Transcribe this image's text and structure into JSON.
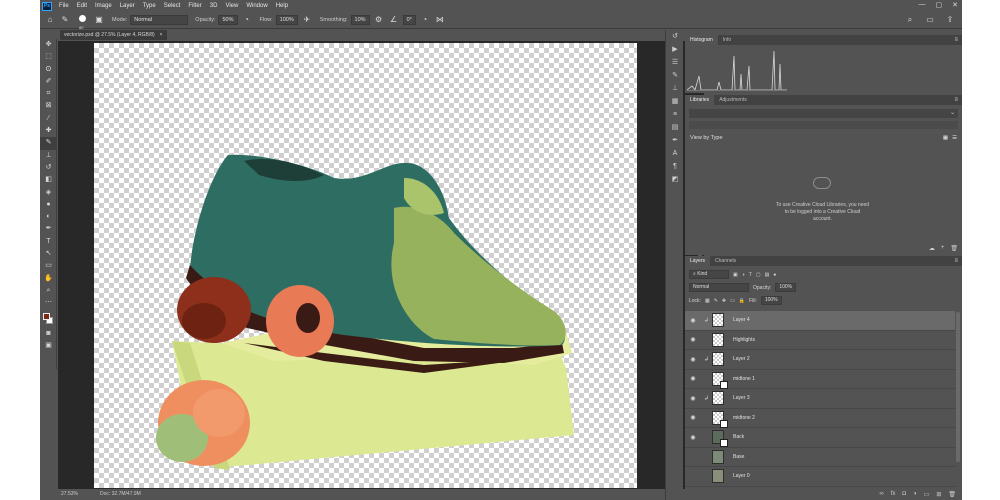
{
  "app": {
    "logo": "Ps"
  },
  "menu": [
    "File",
    "Edit",
    "Image",
    "Layer",
    "Type",
    "Select",
    "Filter",
    "3D",
    "View",
    "Window",
    "Help"
  ],
  "options": {
    "brush_size": "80",
    "mode_label": "Mode:",
    "mode_value": "Normal",
    "opacity_label": "Opacity:",
    "opacity_value": "50%",
    "flow_label": "Flow:",
    "flow_value": "100%",
    "smoothing_label": "Smoothing:",
    "smoothing_value": "10%",
    "angle_value": "0°"
  },
  "document": {
    "tab_title": "vectorize.psd @ 27.5% (Layer 4, RGB/8)",
    "close_glyph": "×",
    "zoom": "27.53%",
    "doc_info": "Doc: 32.7M/47.9M"
  },
  "panels": {
    "histogram": {
      "tabs": [
        "Histogram",
        "Info"
      ]
    },
    "libraries": {
      "tabs": [
        "Libraries",
        "Adjustments"
      ],
      "view_by": "View by Type",
      "message": "To use Creative Cloud Libraries, you need to be logged into a Creative Cloud account."
    },
    "layers": {
      "tabs": [
        "Layers",
        "Channels"
      ],
      "filter_kind": "Kind",
      "blend_mode": "Normal",
      "opacity_label": "Opacity:",
      "opacity_value": "100%",
      "lock_label": "Lock:",
      "fill_label": "Fill:",
      "fill_value": "100%",
      "items": [
        {
          "name": "Layer 4",
          "clipped": true,
          "visible": true,
          "selected": true
        },
        {
          "name": "Highlights",
          "clipped": false,
          "visible": true,
          "selected": false
        },
        {
          "name": "Layer 2",
          "clipped": true,
          "visible": true,
          "selected": false
        },
        {
          "name": "midtone 1",
          "clipped": false,
          "visible": true,
          "selected": false
        },
        {
          "name": "Layer 3",
          "clipped": true,
          "visible": true,
          "selected": false
        },
        {
          "name": "midtone 2",
          "clipped": false,
          "visible": true,
          "selected": false
        },
        {
          "name": "Back",
          "clipped": false,
          "visible": true,
          "selected": false
        },
        {
          "name": "Base",
          "clipped": false,
          "visible": false,
          "selected": false
        },
        {
          "name": "Layer 0",
          "clipped": false,
          "visible": false,
          "selected": false
        }
      ]
    }
  },
  "colors": {
    "foreground": "#7a2a12",
    "background": "#ffffff",
    "accent": "#31a8ff"
  }
}
